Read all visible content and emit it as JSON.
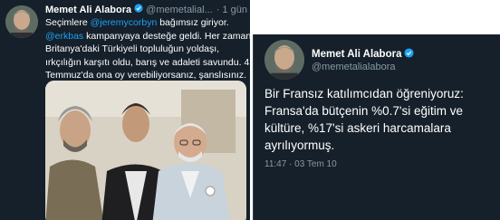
{
  "left_tweet": {
    "name": "Memet Ali Alabora",
    "handle": "@memetalial...",
    "time": "· 1 gün",
    "line1_pre": "Seçimlere ",
    "line1_link": "@jeremycorbyn",
    "line1_post": " bağımsız giriyor.",
    "line2_link": "@erkbas",
    "line2_post": " kampanyaya desteğe geldi. Her zaman",
    "line3": "Britanya'daki Türkiyeli topluluğun yoldaşı,",
    "line4": "ırkçılığın karşıtı oldu, barış ve adaleti savundu. 4",
    "line5": "Temmuz'da ona oy verebiliyorsanız, şanslısınız."
  },
  "right_tweet": {
    "name": "Memet Ali Alabora",
    "handle": "@memetalialabora",
    "line1": "Bir Fransız katılımcıdan öğreniyoruz:",
    "line2": "Fransa'da bütçenin %0.7'si eğitim ve",
    "line3": "kültüre, %17'si askeri harcamalara",
    "line4": "ayrılıyormuş.",
    "timestamp": "11:47 · 03 Tem 10"
  },
  "colors": {
    "background": "#15202b",
    "link": "#1da1f2",
    "muted": "#8899a6",
    "verified": "#1da1f2"
  },
  "icons": {
    "verified": "verified-badge-icon"
  }
}
